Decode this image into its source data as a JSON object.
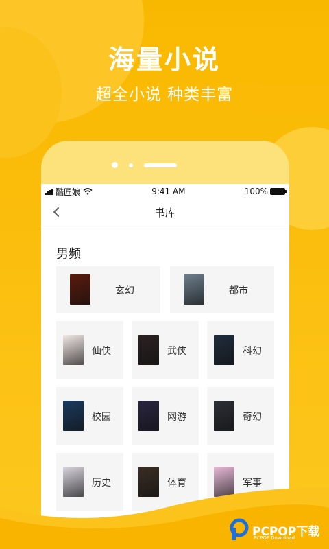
{
  "promo": {
    "headline": "海量小说",
    "subheadline": "超全小说  种类丰富"
  },
  "status_bar": {
    "carrier": "酷匠娘",
    "time": "9:41 AM",
    "battery": "100%",
    "battery_level": 1.0
  },
  "nav": {
    "title": "书库",
    "back_icon": "chevron-left-icon"
  },
  "section": {
    "title": "男频"
  },
  "categories": [
    {
      "label": "玄幻",
      "cover_color": "#5a1a0d"
    },
    {
      "label": "都市",
      "cover_color": "#6d7e8c"
    },
    {
      "label": "仙侠",
      "cover_color": "#f2e8e6"
    },
    {
      "label": "武侠",
      "cover_color": "#2b2222"
    },
    {
      "label": "科幻",
      "cover_color": "#1f2d3d"
    },
    {
      "label": "校园",
      "cover_color": "#1b3a5e"
    },
    {
      "label": "网游",
      "cover_color": "#2a2540"
    },
    {
      "label": "奇幻",
      "cover_color": "#2c2f36"
    },
    {
      "label": "历史",
      "cover_color": "#d9d5de"
    },
    {
      "label": "体育",
      "cover_color": "#3a2e24"
    },
    {
      "label": "军事",
      "cover_color": "#e7b9d8"
    }
  ],
  "brand": {
    "name": "PCPOP下载",
    "sub": "PCPOP Download"
  }
}
